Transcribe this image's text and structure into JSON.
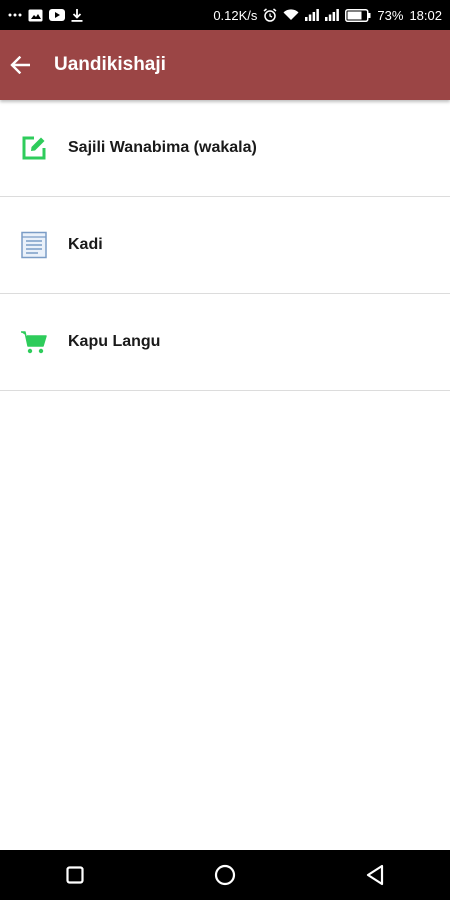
{
  "status_bar": {
    "speed": "0.12K/s",
    "battery": "73%",
    "time": "18:02",
    "left_icons": [
      "more-dots-icon",
      "gallery-icon",
      "youtube-icon",
      "download-icon"
    ],
    "right_icons": [
      "alarm-icon",
      "wifi-icon",
      "signal-icon",
      "signal-icon",
      "battery-icon"
    ]
  },
  "app_bar": {
    "title": "Uandikishaji",
    "back_icon": "arrow-left-icon",
    "color": "#9b4545"
  },
  "menu": {
    "items": [
      {
        "label": "Sajili Wanabima (wakala)",
        "icon": "edit-icon",
        "icon_color": "#2ecc5b"
      },
      {
        "label": "Kadi",
        "icon": "document-icon",
        "icon_color": "#7a9cc6"
      },
      {
        "label": "Kapu Langu",
        "icon": "cart-icon",
        "icon_color": "#2ecc5b"
      }
    ]
  },
  "nav_bar": {
    "buttons": [
      "recents-square-icon",
      "home-circle-icon",
      "back-triangle-icon"
    ]
  }
}
